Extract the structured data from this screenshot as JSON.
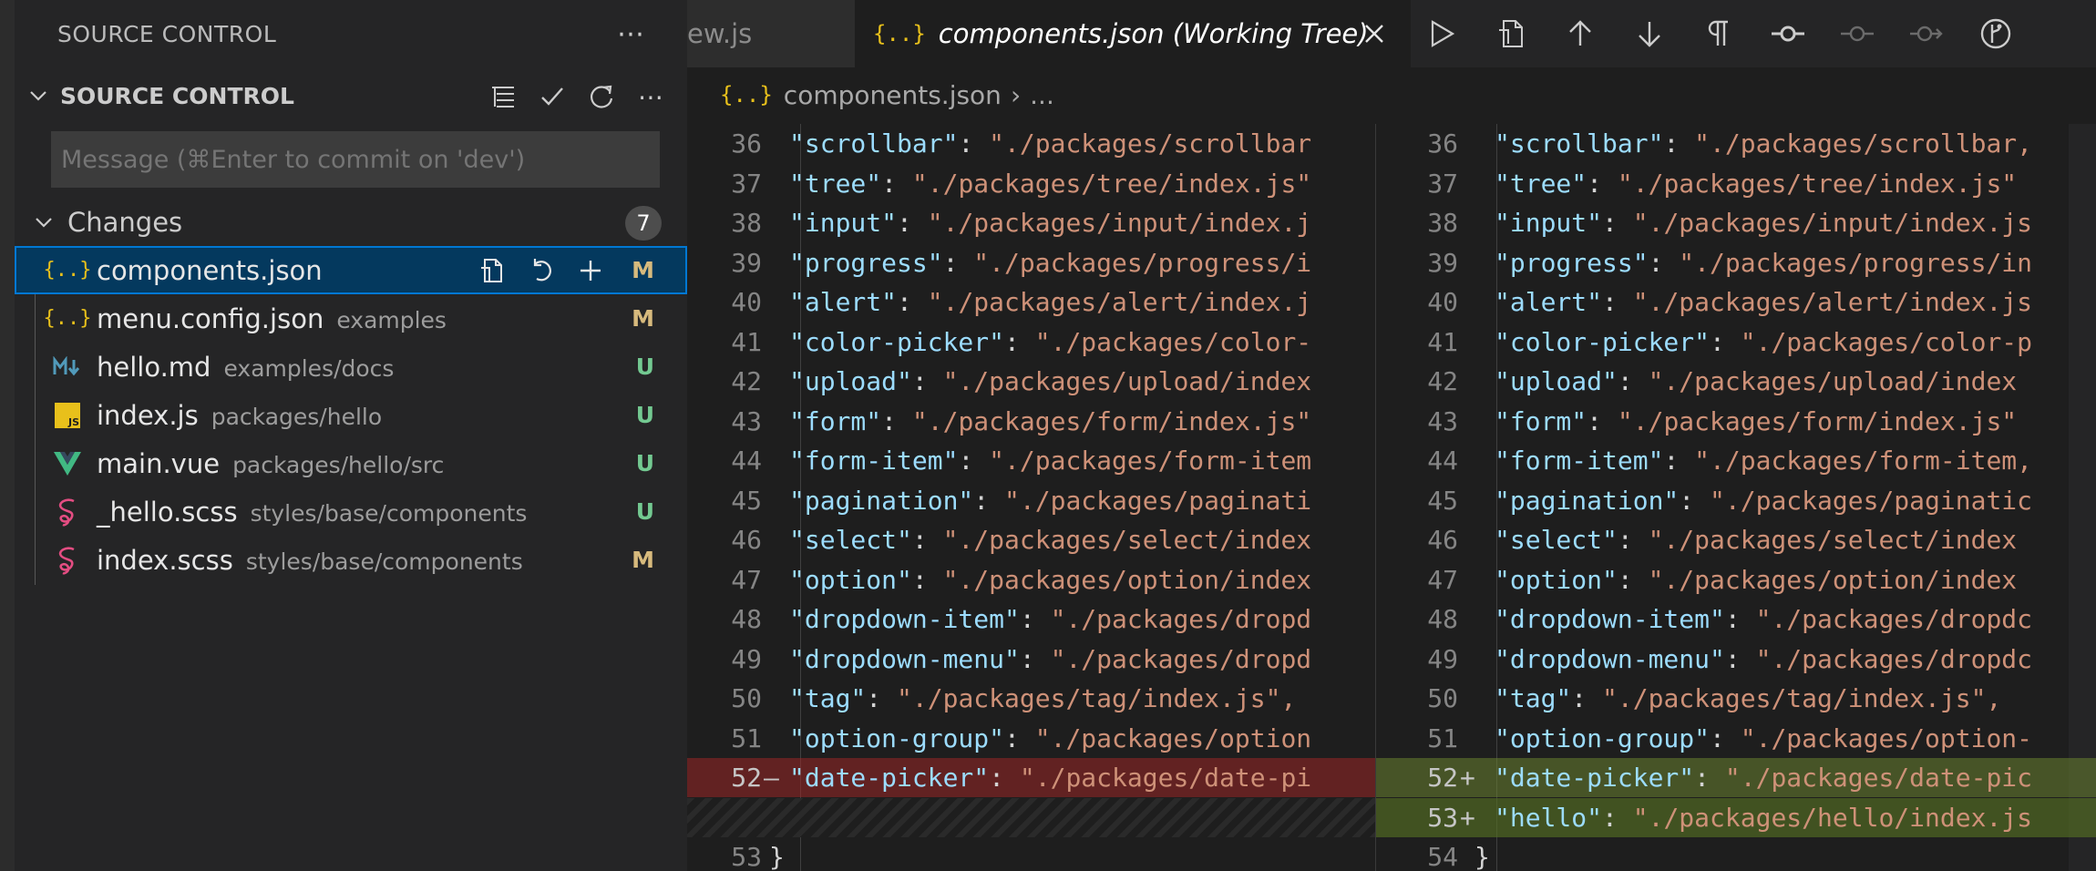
{
  "sidebar": {
    "panel_title": "SOURCE CONTROL",
    "section_title": "SOURCE CONTROL",
    "commit_placeholder": "Message (⌘Enter to commit on 'dev')",
    "changes_label": "Changes",
    "changes_count": "7",
    "files": [
      {
        "name": "components.json",
        "path": "",
        "status": "M",
        "icon": "json-file-icon",
        "selected": true
      },
      {
        "name": "menu.config.json",
        "path": "examples",
        "status": "M",
        "icon": "json-file-icon"
      },
      {
        "name": "hello.md",
        "path": "examples/docs",
        "status": "U",
        "icon": "markdown-file-icon"
      },
      {
        "name": "index.js",
        "path": "packages/hello",
        "status": "U",
        "icon": "js-file-icon"
      },
      {
        "name": "main.vue",
        "path": "packages/hello/src",
        "status": "U",
        "icon": "vue-file-icon"
      },
      {
        "name": "_hello.scss",
        "path": "styles/base/components",
        "status": "U",
        "icon": "scss-file-icon"
      },
      {
        "name": "index.scss",
        "path": "styles/base/components",
        "status": "M",
        "icon": "scss-file-icon"
      }
    ]
  },
  "colors": {
    "modified": "#d7ba7d",
    "untracked": "#73c991",
    "accent": "#0078d4",
    "json_icon": "#e8c01b"
  },
  "tabs": {
    "prev_label": "ew.js",
    "active_label": "components.json (Working Tree)",
    "json_glyph": "{..}"
  },
  "breadcrumb": {
    "file": "components.json",
    "sep": "›",
    "rest": "..."
  },
  "diff": {
    "left": [
      {
        "ln": "36",
        "key": "\"scrollbar\"",
        "val": " \"./packages/scrollbar"
      },
      {
        "ln": "37",
        "key": "\"tree\"",
        "val": " \"./packages/tree/index.js\""
      },
      {
        "ln": "38",
        "key": "\"input\"",
        "val": " \"./packages/input/index.j"
      },
      {
        "ln": "39",
        "key": "\"progress\"",
        "val": " \"./packages/progress/i"
      },
      {
        "ln": "40",
        "key": "\"alert\"",
        "val": " \"./packages/alert/index.j"
      },
      {
        "ln": "41",
        "key": "\"color-picker\"",
        "val": " \"./packages/color-"
      },
      {
        "ln": "42",
        "key": "\"upload\"",
        "val": " \"./packages/upload/index"
      },
      {
        "ln": "43",
        "key": "\"form\"",
        "val": " \"./packages/form/index.js\""
      },
      {
        "ln": "44",
        "key": "\"form-item\"",
        "val": " \"./packages/form-item"
      },
      {
        "ln": "45",
        "key": "\"pagination\"",
        "val": " \"./packages/paginati"
      },
      {
        "ln": "46",
        "key": "\"select\"",
        "val": " \"./packages/select/index"
      },
      {
        "ln": "47",
        "key": "\"option\"",
        "val": " \"./packages/option/index"
      },
      {
        "ln": "48",
        "key": "\"dropdown-item\"",
        "val": " \"./packages/dropd"
      },
      {
        "ln": "49",
        "key": "\"dropdown-menu\"",
        "val": " \"./packages/dropd"
      },
      {
        "ln": "50",
        "key": "\"tag\"",
        "val": " \"./packages/tag/index.js\","
      },
      {
        "ln": "51",
        "key": "\"option-group\"",
        "val": " \"./packages/option"
      },
      {
        "ln": "52",
        "key": "\"date-picker\"",
        "val": " \"./packages/date-pi",
        "sign": "—",
        "type": "del"
      },
      {
        "ln": "",
        "key": "",
        "val": "",
        "type": "filler"
      },
      {
        "ln": "53",
        "key": "",
        "val": "}",
        "type": "brace"
      }
    ],
    "right": [
      {
        "ln": "36",
        "key": "\"scrollbar\"",
        "val": " \"./packages/scrollbar,"
      },
      {
        "ln": "37",
        "key": "\"tree\"",
        "val": " \"./packages/tree/index.js\""
      },
      {
        "ln": "38",
        "key": "\"input\"",
        "val": " \"./packages/input/index.js"
      },
      {
        "ln": "39",
        "key": "\"progress\"",
        "val": " \"./packages/progress/in"
      },
      {
        "ln": "40",
        "key": "\"alert\"",
        "val": " \"./packages/alert/index.js"
      },
      {
        "ln": "41",
        "key": "\"color-picker\"",
        "val": " \"./packages/color-p"
      },
      {
        "ln": "42",
        "key": "\"upload\"",
        "val": " \"./packages/upload/index"
      },
      {
        "ln": "43",
        "key": "\"form\"",
        "val": " \"./packages/form/index.js\""
      },
      {
        "ln": "44",
        "key": "\"form-item\"",
        "val": " \"./packages/form-item,"
      },
      {
        "ln": "45",
        "key": "\"pagination\"",
        "val": " \"./packages/paginatic"
      },
      {
        "ln": "46",
        "key": "\"select\"",
        "val": " \"./packages/select/index"
      },
      {
        "ln": "47",
        "key": "\"option\"",
        "val": " \"./packages/option/index"
      },
      {
        "ln": "48",
        "key": "\"dropdown-item\"",
        "val": " \"./packages/dropdc"
      },
      {
        "ln": "49",
        "key": "\"dropdown-menu\"",
        "val": " \"./packages/dropdc"
      },
      {
        "ln": "50",
        "key": "\"tag\"",
        "val": " \"./packages/tag/index.js\","
      },
      {
        "ln": "51",
        "key": "\"option-group\"",
        "val": " \"./packages/option-"
      },
      {
        "ln": "52",
        "key": "\"date-picker\"",
        "val": " \"./packages/date-pic",
        "sign": "+",
        "type": "ins"
      },
      {
        "ln": "53",
        "key": "\"hello\"",
        "val": " \"./packages/hello/index.js",
        "sign": "+",
        "type": "ins-full"
      },
      {
        "ln": "54",
        "key": "",
        "val": "}",
        "type": "brace"
      }
    ]
  }
}
